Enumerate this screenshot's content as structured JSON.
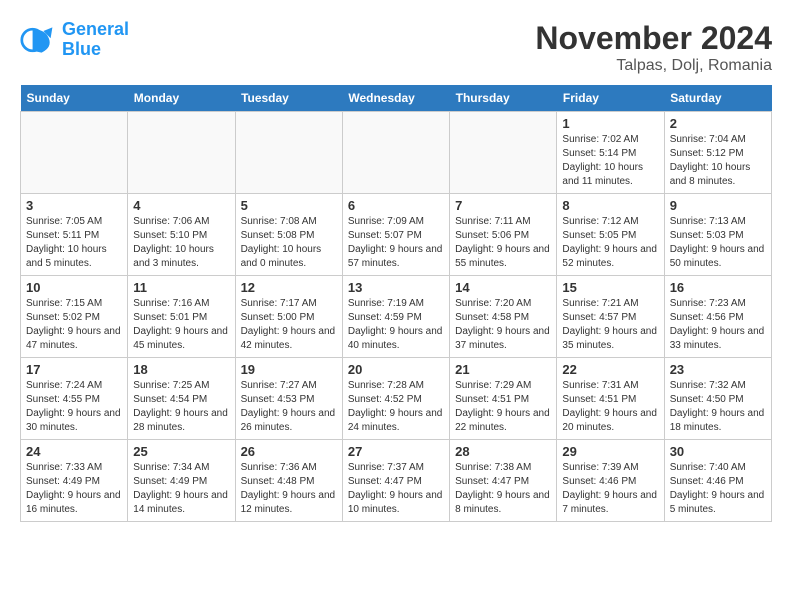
{
  "logo": {
    "line1": "General",
    "line2": "Blue"
  },
  "title": "November 2024",
  "location": "Talpas, Dolj, Romania",
  "days_of_week": [
    "Sunday",
    "Monday",
    "Tuesday",
    "Wednesday",
    "Thursday",
    "Friday",
    "Saturday"
  ],
  "weeks": [
    [
      {
        "day": "",
        "info": ""
      },
      {
        "day": "",
        "info": ""
      },
      {
        "day": "",
        "info": ""
      },
      {
        "day": "",
        "info": ""
      },
      {
        "day": "",
        "info": ""
      },
      {
        "day": "1",
        "info": "Sunrise: 7:02 AM\nSunset: 5:14 PM\nDaylight: 10 hours and 11 minutes."
      },
      {
        "day": "2",
        "info": "Sunrise: 7:04 AM\nSunset: 5:12 PM\nDaylight: 10 hours and 8 minutes."
      }
    ],
    [
      {
        "day": "3",
        "info": "Sunrise: 7:05 AM\nSunset: 5:11 PM\nDaylight: 10 hours and 5 minutes."
      },
      {
        "day": "4",
        "info": "Sunrise: 7:06 AM\nSunset: 5:10 PM\nDaylight: 10 hours and 3 minutes."
      },
      {
        "day": "5",
        "info": "Sunrise: 7:08 AM\nSunset: 5:08 PM\nDaylight: 10 hours and 0 minutes."
      },
      {
        "day": "6",
        "info": "Sunrise: 7:09 AM\nSunset: 5:07 PM\nDaylight: 9 hours and 57 minutes."
      },
      {
        "day": "7",
        "info": "Sunrise: 7:11 AM\nSunset: 5:06 PM\nDaylight: 9 hours and 55 minutes."
      },
      {
        "day": "8",
        "info": "Sunrise: 7:12 AM\nSunset: 5:05 PM\nDaylight: 9 hours and 52 minutes."
      },
      {
        "day": "9",
        "info": "Sunrise: 7:13 AM\nSunset: 5:03 PM\nDaylight: 9 hours and 50 minutes."
      }
    ],
    [
      {
        "day": "10",
        "info": "Sunrise: 7:15 AM\nSunset: 5:02 PM\nDaylight: 9 hours and 47 minutes."
      },
      {
        "day": "11",
        "info": "Sunrise: 7:16 AM\nSunset: 5:01 PM\nDaylight: 9 hours and 45 minutes."
      },
      {
        "day": "12",
        "info": "Sunrise: 7:17 AM\nSunset: 5:00 PM\nDaylight: 9 hours and 42 minutes."
      },
      {
        "day": "13",
        "info": "Sunrise: 7:19 AM\nSunset: 4:59 PM\nDaylight: 9 hours and 40 minutes."
      },
      {
        "day": "14",
        "info": "Sunrise: 7:20 AM\nSunset: 4:58 PM\nDaylight: 9 hours and 37 minutes."
      },
      {
        "day": "15",
        "info": "Sunrise: 7:21 AM\nSunset: 4:57 PM\nDaylight: 9 hours and 35 minutes."
      },
      {
        "day": "16",
        "info": "Sunrise: 7:23 AM\nSunset: 4:56 PM\nDaylight: 9 hours and 33 minutes."
      }
    ],
    [
      {
        "day": "17",
        "info": "Sunrise: 7:24 AM\nSunset: 4:55 PM\nDaylight: 9 hours and 30 minutes."
      },
      {
        "day": "18",
        "info": "Sunrise: 7:25 AM\nSunset: 4:54 PM\nDaylight: 9 hours and 28 minutes."
      },
      {
        "day": "19",
        "info": "Sunrise: 7:27 AM\nSunset: 4:53 PM\nDaylight: 9 hours and 26 minutes."
      },
      {
        "day": "20",
        "info": "Sunrise: 7:28 AM\nSunset: 4:52 PM\nDaylight: 9 hours and 24 minutes."
      },
      {
        "day": "21",
        "info": "Sunrise: 7:29 AM\nSunset: 4:51 PM\nDaylight: 9 hours and 22 minutes."
      },
      {
        "day": "22",
        "info": "Sunrise: 7:31 AM\nSunset: 4:51 PM\nDaylight: 9 hours and 20 minutes."
      },
      {
        "day": "23",
        "info": "Sunrise: 7:32 AM\nSunset: 4:50 PM\nDaylight: 9 hours and 18 minutes."
      }
    ],
    [
      {
        "day": "24",
        "info": "Sunrise: 7:33 AM\nSunset: 4:49 PM\nDaylight: 9 hours and 16 minutes."
      },
      {
        "day": "25",
        "info": "Sunrise: 7:34 AM\nSunset: 4:49 PM\nDaylight: 9 hours and 14 minutes."
      },
      {
        "day": "26",
        "info": "Sunrise: 7:36 AM\nSunset: 4:48 PM\nDaylight: 9 hours and 12 minutes."
      },
      {
        "day": "27",
        "info": "Sunrise: 7:37 AM\nSunset: 4:47 PM\nDaylight: 9 hours and 10 minutes."
      },
      {
        "day": "28",
        "info": "Sunrise: 7:38 AM\nSunset: 4:47 PM\nDaylight: 9 hours and 8 minutes."
      },
      {
        "day": "29",
        "info": "Sunrise: 7:39 AM\nSunset: 4:46 PM\nDaylight: 9 hours and 7 minutes."
      },
      {
        "day": "30",
        "info": "Sunrise: 7:40 AM\nSunset: 4:46 PM\nDaylight: 9 hours and 5 minutes."
      }
    ]
  ]
}
